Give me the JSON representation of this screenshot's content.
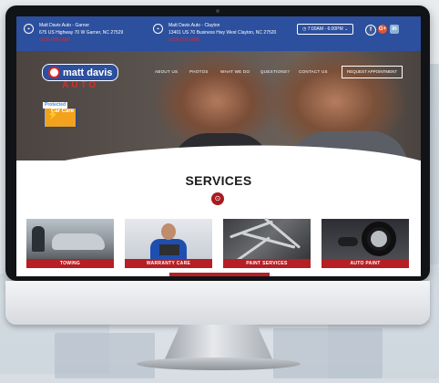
{
  "topbar": {
    "locations": [
      {
        "name": "Matt Davis Auto - Garner",
        "address": "675 US Highway 70 W Garner, NC 27529",
        "phone": "(919) 000-0000"
      },
      {
        "name": "Matt Davis Auto - Clayton",
        "address": "13401 US 70 Business Hwy West Clayton, NC 27520",
        "phone": "(919) 000-0000"
      }
    ],
    "hours": "7:00AM - 6:00PM",
    "hours_chevron": "⌄",
    "social": {
      "facebook": "f",
      "google": "G+",
      "instagram": "in"
    }
  },
  "hero": {
    "logo_text": "matt davis",
    "logo_sub": "AUTO",
    "badge_text": "Protected",
    "car_care_text": "Car Care"
  },
  "nav": {
    "items": [
      "ABOUT US",
      "PHOTOS",
      "WHAT WE DO",
      "QUESTIONS?",
      "CONTACT US"
    ],
    "cta": "REQUEST APPOINTMENT"
  },
  "services": {
    "title": "SERVICES",
    "cards": [
      "TOWING",
      "WARRANTY CARE",
      "PAINT SERVICES",
      "AUTO PAINT"
    ]
  },
  "colors": {
    "topbar_blue": "#2c4f9e",
    "accent_red": "#b51f25",
    "phone_red": "#e02a2a"
  }
}
